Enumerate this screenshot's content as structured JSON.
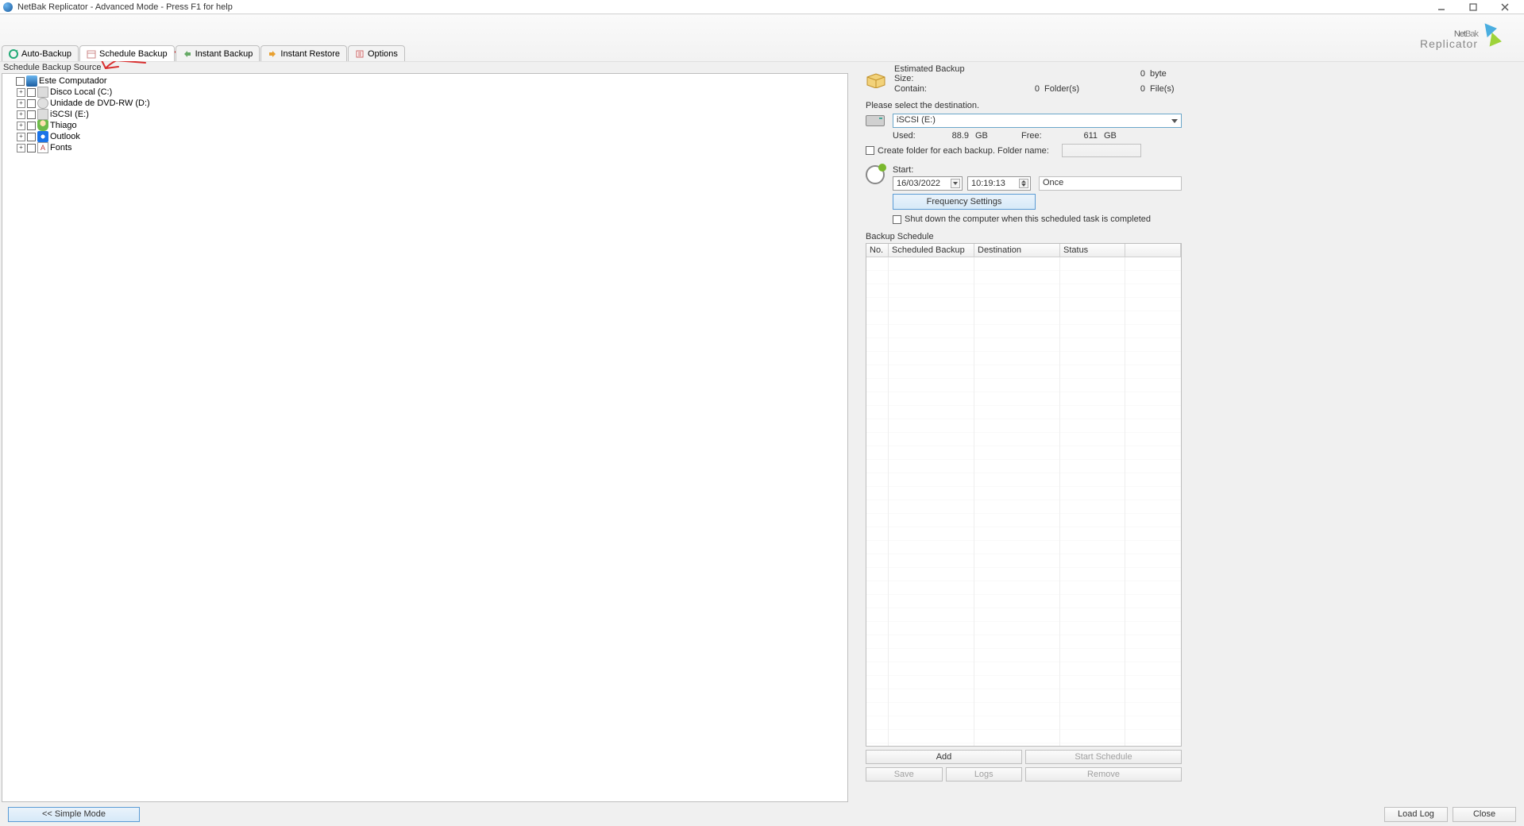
{
  "window": {
    "title": "NetBak Replicator - Advanced Mode - Press F1 for help"
  },
  "logo": {
    "line1_net": "Net",
    "line1_bak": "Bak",
    "line2": "Replicator"
  },
  "tabs": {
    "auto_backup": "Auto-Backup",
    "schedule_backup": "Schedule Backup",
    "instant_backup": "Instant Backup",
    "instant_restore": "Instant Restore",
    "options": "Options"
  },
  "source": {
    "header": "Schedule Backup Source",
    "root": "Este Computador",
    "children": [
      "Disco Local (C:)",
      "Unidade de DVD-RW (D:)",
      "iSCSI (E:)",
      "Thiago",
      "Outlook",
      "Fonts"
    ]
  },
  "stats": {
    "est_label": "Estimated Backup Size:",
    "est_value": "0",
    "est_unit": "byte",
    "contain_label": "Contain:",
    "folders_value": "0",
    "folders_unit": "Folder(s)",
    "files_value": "0",
    "files_unit": "File(s)"
  },
  "dest": {
    "prompt": "Please select the destination.",
    "selected": "iSCSI (E:)",
    "used_label": "Used:",
    "used_value": "88.9",
    "used_unit": "GB",
    "free_label": "Free:",
    "free_value": "611",
    "free_unit": "GB",
    "create_folder_label": "Create folder for each backup. Folder name:"
  },
  "sched": {
    "start_label": "Start:",
    "date": "16/03/2022",
    "time": "10:19:13",
    "recurrence": "Once",
    "freq_btn": "Frequency Settings",
    "shutdown_label": "Shut down the computer when this scheduled task is completed"
  },
  "schedule_table": {
    "title": "Backup Schedule",
    "col_no": "No.",
    "col_sched": "Scheduled Backup",
    "col_dest": "Destination",
    "col_status": "Status"
  },
  "actions": {
    "add": "Add",
    "start": "Start Schedule",
    "save": "Save",
    "logs": "Logs",
    "remove": "Remove"
  },
  "footer": {
    "simple_mode": "<< Simple Mode",
    "load_log": "Load Log",
    "close": "Close"
  }
}
